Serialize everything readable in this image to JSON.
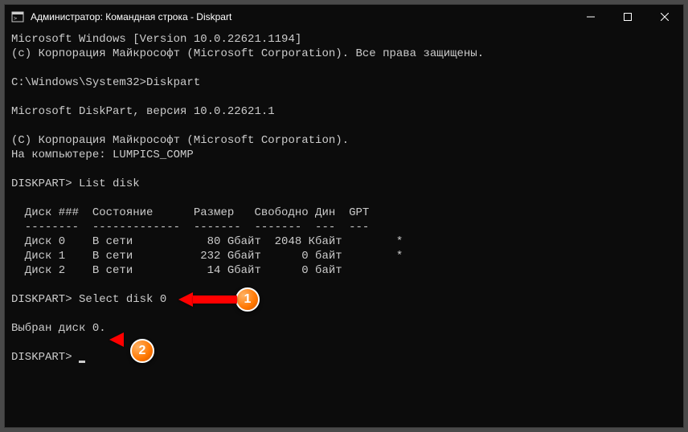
{
  "window": {
    "title": "Администратор: Командная строка - Diskpart"
  },
  "terminal": {
    "line1": "Microsoft Windows [Version 10.0.22621.1194]",
    "line2": "(c) Корпорация Майкрософт (Microsoft Corporation). Все права защищены.",
    "blank1": "",
    "line3": "C:\\Windows\\System32>Diskpart",
    "blank2": "",
    "line4": "Microsoft DiskPart, версия 10.0.22621.1",
    "blank3": "",
    "line5": "(C) Корпорация Майкрософт (Microsoft Corporation).",
    "line6": "На компьютере: LUMPICS_COMP",
    "blank4": "",
    "line7": "DISKPART> List disk",
    "blank5": "",
    "table_header": "  Диск ###  Состояние      Размер   Свободно Дин  GPT",
    "table_divider": "  --------  -------------  -------  -------  ---  ---",
    "table_row0": "  Диск 0    В сети           80 Gбайт  2048 Кбайт        *",
    "table_row1": "  Диск 1    В сети          232 Gбайт      0 байт        *",
    "table_row2": "  Диск 2    В сети           14 Gбайт      0 байт",
    "blank6": "",
    "line8": "DISKPART> Select disk 0",
    "blank7": "",
    "line9": "Выбран диск 0.",
    "blank8": "",
    "line10": "DISKPART> "
  },
  "annotations": {
    "badge1": "1",
    "badge2": "2"
  }
}
